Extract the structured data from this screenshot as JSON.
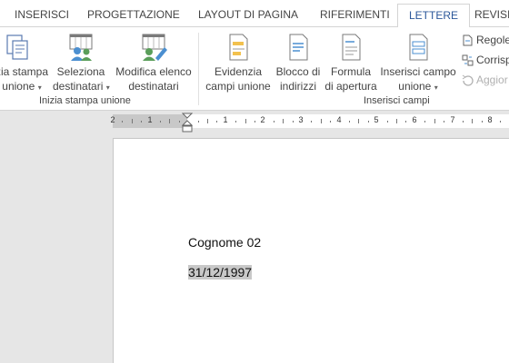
{
  "tabs": [
    "INSERISCI",
    "PROGETTAZIONE",
    "LAYOUT DI PAGINA",
    "RIFERIMENTI",
    "LETTERE",
    "REVISIONE"
  ],
  "active_tab": "LETTERE",
  "ribbon": {
    "groups": {
      "start": {
        "label": "Inizia stampa unione",
        "buttons": [
          {
            "line1": "zia stampa",
            "line2": "unione",
            "icon": "start-mail-merge-icon"
          },
          {
            "line1": "Seleziona",
            "line2": "destinatari",
            "icon": "select-recipients-icon"
          },
          {
            "line1": "Modifica elenco",
            "line2": "destinatari",
            "icon": "edit-recipient-list-icon"
          }
        ]
      },
      "fields": {
        "label": "Inserisci campi",
        "buttons": [
          {
            "line1": "Evidenzia",
            "line2": "campi unione",
            "icon": "highlight-merge-fields-icon"
          },
          {
            "line1": "Blocco di",
            "line2": "indirizzi",
            "icon": "address-block-icon"
          },
          {
            "line1": "Formula",
            "line2": "di apertura",
            "icon": "greeting-line-icon"
          },
          {
            "line1": "Inserisci campo",
            "line2": "unione",
            "icon": "insert-merge-field-icon"
          }
        ],
        "small": [
          {
            "label": "Regole",
            "icon": "rules-icon"
          },
          {
            "label": "Corrisp",
            "icon": "match-fields-icon"
          },
          {
            "label": "Aggior",
            "icon": "update-labels-icon"
          }
        ]
      }
    }
  },
  "ruler": {
    "numbers": [
      "2",
      "1",
      "1",
      "2",
      "3",
      "4",
      "5",
      "6",
      "7",
      "8"
    ]
  },
  "document": {
    "line1": "Cognome 02",
    "line2": "31/12/1997"
  }
}
